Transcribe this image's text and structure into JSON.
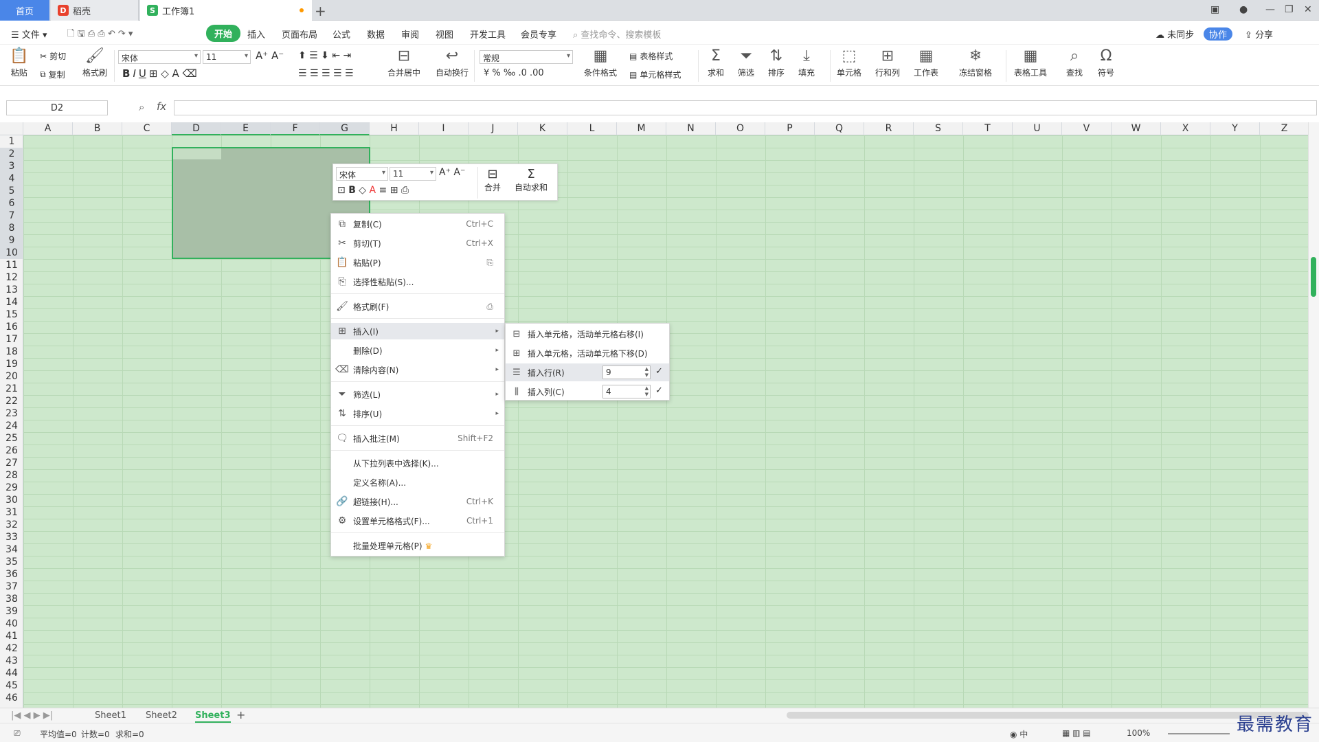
{
  "tabs": {
    "home": "首页",
    "doc1": "稻壳",
    "doc2": "工作簿1",
    "new": "+"
  },
  "menu": {
    "file": "文件",
    "items": [
      "开始",
      "插入",
      "页面布局",
      "公式",
      "数据",
      "审阅",
      "视图",
      "开发工具",
      "会员专享"
    ],
    "search_placeholder": "查找命令、搜索模板",
    "cloud": "未同步",
    "cowork": "协作",
    "share": "分享"
  },
  "ribbon": {
    "cut": "剪切",
    "paste": "粘贴",
    "copy": "复制",
    "format_painter": "格式刷",
    "font": "宋体",
    "size": "11",
    "number_format": "常规",
    "merge_center": "合并居中",
    "wrap": "自动换行",
    "cond_format": "条件格式",
    "table_style": "表格样式",
    "cell_style": "单元格样式",
    "sum": "求和",
    "filter": "筛选",
    "sort": "排序",
    "fill": "填充",
    "cell": "单元格",
    "rowcol": "行和列",
    "sheet": "工作表",
    "freeze": "冻结窗格",
    "table_tools": "表格工具",
    "find": "查找",
    "symbol": "符号"
  },
  "formula": {
    "name_box": "D2",
    "fx": "fx"
  },
  "columns": [
    "A",
    "B",
    "C",
    "D",
    "E",
    "F",
    "G",
    "H",
    "I",
    "J",
    "K",
    "L",
    "M",
    "N",
    "O",
    "P",
    "Q",
    "R",
    "S",
    "T",
    "U",
    "V",
    "W",
    "X",
    "Y",
    "Z"
  ],
  "rows": [
    "1",
    "2",
    "3",
    "4",
    "5",
    "6",
    "7",
    "8",
    "9",
    "10",
    "11",
    "12",
    "13",
    "14",
    "15",
    "16",
    "17",
    "18",
    "19",
    "20",
    "21",
    "22",
    "23",
    "24",
    "25",
    "26",
    "27",
    "28",
    "29",
    "30",
    "31",
    "32",
    "33",
    "34",
    "35",
    "36",
    "37",
    "38",
    "39",
    "40",
    "41",
    "42",
    "43",
    "44",
    "45",
    "46"
  ],
  "mini_toolbar": {
    "font": "宋体",
    "size": "11",
    "merge": "合并",
    "autosum": "自动求和"
  },
  "context_menu": {
    "copy": "复制(C)",
    "copy_sc": "Ctrl+C",
    "cut": "剪切(T)",
    "cut_sc": "Ctrl+X",
    "paste": "粘贴(P)",
    "paste_special": "选择性粘贴(S)...",
    "format_painter": "格式刷(F)",
    "insert": "插入(I)",
    "delete": "删除(D)",
    "clear": "清除内容(N)",
    "filter": "筛选(L)",
    "sort": "排序(U)",
    "comment": "插入批注(M)",
    "comment_sc": "Shift+F2",
    "dropdown": "从下拉列表中选择(K)...",
    "define_name": "定义名称(A)...",
    "hyperlink": "超链接(H)...",
    "hyperlink_sc": "Ctrl+K",
    "cell_format": "设置单元格格式(F)...",
    "cell_format_sc": "Ctrl+1",
    "batch": "批量处理单元格(P)"
  },
  "insert_submenu": {
    "shift_right": "插入单元格，活动单元格右移(I)",
    "shift_down": "插入单元格，活动单元格下移(D)",
    "insert_row": "插入行(R)",
    "row_count": "9",
    "insert_col": "插入列(C)",
    "col_count": "4"
  },
  "sheets": [
    "Sheet1",
    "Sheet2",
    "Sheet3"
  ],
  "status": {
    "avg": "平均值=0",
    "count": "计数=0",
    "sum": "求和=0",
    "zoom": "100%",
    "brand": "最需教育"
  }
}
